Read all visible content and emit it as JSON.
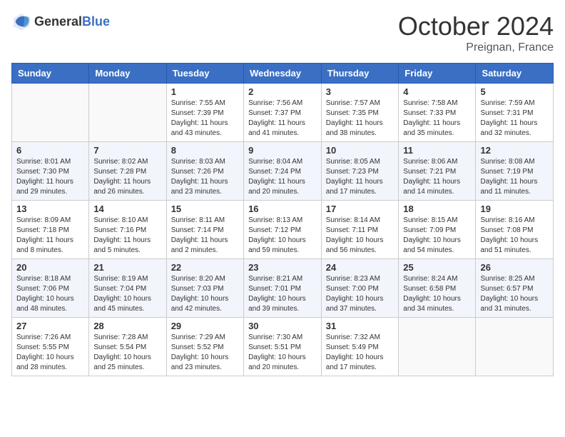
{
  "logo": {
    "text_general": "General",
    "text_blue": "Blue"
  },
  "header": {
    "month": "October 2024",
    "location": "Preignan, France"
  },
  "weekdays": [
    "Sunday",
    "Monday",
    "Tuesday",
    "Wednesday",
    "Thursday",
    "Friday",
    "Saturday"
  ],
  "weeks": [
    [
      {
        "day": "",
        "sunrise": "",
        "sunset": "",
        "daylight": ""
      },
      {
        "day": "",
        "sunrise": "",
        "sunset": "",
        "daylight": ""
      },
      {
        "day": "1",
        "sunrise": "Sunrise: 7:55 AM",
        "sunset": "Sunset: 7:39 PM",
        "daylight": "Daylight: 11 hours and 43 minutes."
      },
      {
        "day": "2",
        "sunrise": "Sunrise: 7:56 AM",
        "sunset": "Sunset: 7:37 PM",
        "daylight": "Daylight: 11 hours and 41 minutes."
      },
      {
        "day": "3",
        "sunrise": "Sunrise: 7:57 AM",
        "sunset": "Sunset: 7:35 PM",
        "daylight": "Daylight: 11 hours and 38 minutes."
      },
      {
        "day": "4",
        "sunrise": "Sunrise: 7:58 AM",
        "sunset": "Sunset: 7:33 PM",
        "daylight": "Daylight: 11 hours and 35 minutes."
      },
      {
        "day": "5",
        "sunrise": "Sunrise: 7:59 AM",
        "sunset": "Sunset: 7:31 PM",
        "daylight": "Daylight: 11 hours and 32 minutes."
      }
    ],
    [
      {
        "day": "6",
        "sunrise": "Sunrise: 8:01 AM",
        "sunset": "Sunset: 7:30 PM",
        "daylight": "Daylight: 11 hours and 29 minutes."
      },
      {
        "day": "7",
        "sunrise": "Sunrise: 8:02 AM",
        "sunset": "Sunset: 7:28 PM",
        "daylight": "Daylight: 11 hours and 26 minutes."
      },
      {
        "day": "8",
        "sunrise": "Sunrise: 8:03 AM",
        "sunset": "Sunset: 7:26 PM",
        "daylight": "Daylight: 11 hours and 23 minutes."
      },
      {
        "day": "9",
        "sunrise": "Sunrise: 8:04 AM",
        "sunset": "Sunset: 7:24 PM",
        "daylight": "Daylight: 11 hours and 20 minutes."
      },
      {
        "day": "10",
        "sunrise": "Sunrise: 8:05 AM",
        "sunset": "Sunset: 7:23 PM",
        "daylight": "Daylight: 11 hours and 17 minutes."
      },
      {
        "day": "11",
        "sunrise": "Sunrise: 8:06 AM",
        "sunset": "Sunset: 7:21 PM",
        "daylight": "Daylight: 11 hours and 14 minutes."
      },
      {
        "day": "12",
        "sunrise": "Sunrise: 8:08 AM",
        "sunset": "Sunset: 7:19 PM",
        "daylight": "Daylight: 11 hours and 11 minutes."
      }
    ],
    [
      {
        "day": "13",
        "sunrise": "Sunrise: 8:09 AM",
        "sunset": "Sunset: 7:18 PM",
        "daylight": "Daylight: 11 hours and 8 minutes."
      },
      {
        "day": "14",
        "sunrise": "Sunrise: 8:10 AM",
        "sunset": "Sunset: 7:16 PM",
        "daylight": "Daylight: 11 hours and 5 minutes."
      },
      {
        "day": "15",
        "sunrise": "Sunrise: 8:11 AM",
        "sunset": "Sunset: 7:14 PM",
        "daylight": "Daylight: 11 hours and 2 minutes."
      },
      {
        "day": "16",
        "sunrise": "Sunrise: 8:13 AM",
        "sunset": "Sunset: 7:12 PM",
        "daylight": "Daylight: 10 hours and 59 minutes."
      },
      {
        "day": "17",
        "sunrise": "Sunrise: 8:14 AM",
        "sunset": "Sunset: 7:11 PM",
        "daylight": "Daylight: 10 hours and 56 minutes."
      },
      {
        "day": "18",
        "sunrise": "Sunrise: 8:15 AM",
        "sunset": "Sunset: 7:09 PM",
        "daylight": "Daylight: 10 hours and 54 minutes."
      },
      {
        "day": "19",
        "sunrise": "Sunrise: 8:16 AM",
        "sunset": "Sunset: 7:08 PM",
        "daylight": "Daylight: 10 hours and 51 minutes."
      }
    ],
    [
      {
        "day": "20",
        "sunrise": "Sunrise: 8:18 AM",
        "sunset": "Sunset: 7:06 PM",
        "daylight": "Daylight: 10 hours and 48 minutes."
      },
      {
        "day": "21",
        "sunrise": "Sunrise: 8:19 AM",
        "sunset": "Sunset: 7:04 PM",
        "daylight": "Daylight: 10 hours and 45 minutes."
      },
      {
        "day": "22",
        "sunrise": "Sunrise: 8:20 AM",
        "sunset": "Sunset: 7:03 PM",
        "daylight": "Daylight: 10 hours and 42 minutes."
      },
      {
        "day": "23",
        "sunrise": "Sunrise: 8:21 AM",
        "sunset": "Sunset: 7:01 PM",
        "daylight": "Daylight: 10 hours and 39 minutes."
      },
      {
        "day": "24",
        "sunrise": "Sunrise: 8:23 AM",
        "sunset": "Sunset: 7:00 PM",
        "daylight": "Daylight: 10 hours and 37 minutes."
      },
      {
        "day": "25",
        "sunrise": "Sunrise: 8:24 AM",
        "sunset": "Sunset: 6:58 PM",
        "daylight": "Daylight: 10 hours and 34 minutes."
      },
      {
        "day": "26",
        "sunrise": "Sunrise: 8:25 AM",
        "sunset": "Sunset: 6:57 PM",
        "daylight": "Daylight: 10 hours and 31 minutes."
      }
    ],
    [
      {
        "day": "27",
        "sunrise": "Sunrise: 7:26 AM",
        "sunset": "Sunset: 5:55 PM",
        "daylight": "Daylight: 10 hours and 28 minutes."
      },
      {
        "day": "28",
        "sunrise": "Sunrise: 7:28 AM",
        "sunset": "Sunset: 5:54 PM",
        "daylight": "Daylight: 10 hours and 25 minutes."
      },
      {
        "day": "29",
        "sunrise": "Sunrise: 7:29 AM",
        "sunset": "Sunset: 5:52 PM",
        "daylight": "Daylight: 10 hours and 23 minutes."
      },
      {
        "day": "30",
        "sunrise": "Sunrise: 7:30 AM",
        "sunset": "Sunset: 5:51 PM",
        "daylight": "Daylight: 10 hours and 20 minutes."
      },
      {
        "day": "31",
        "sunrise": "Sunrise: 7:32 AM",
        "sunset": "Sunset: 5:49 PM",
        "daylight": "Daylight: 10 hours and 17 minutes."
      },
      {
        "day": "",
        "sunrise": "",
        "sunset": "",
        "daylight": ""
      },
      {
        "day": "",
        "sunrise": "",
        "sunset": "",
        "daylight": ""
      }
    ]
  ]
}
